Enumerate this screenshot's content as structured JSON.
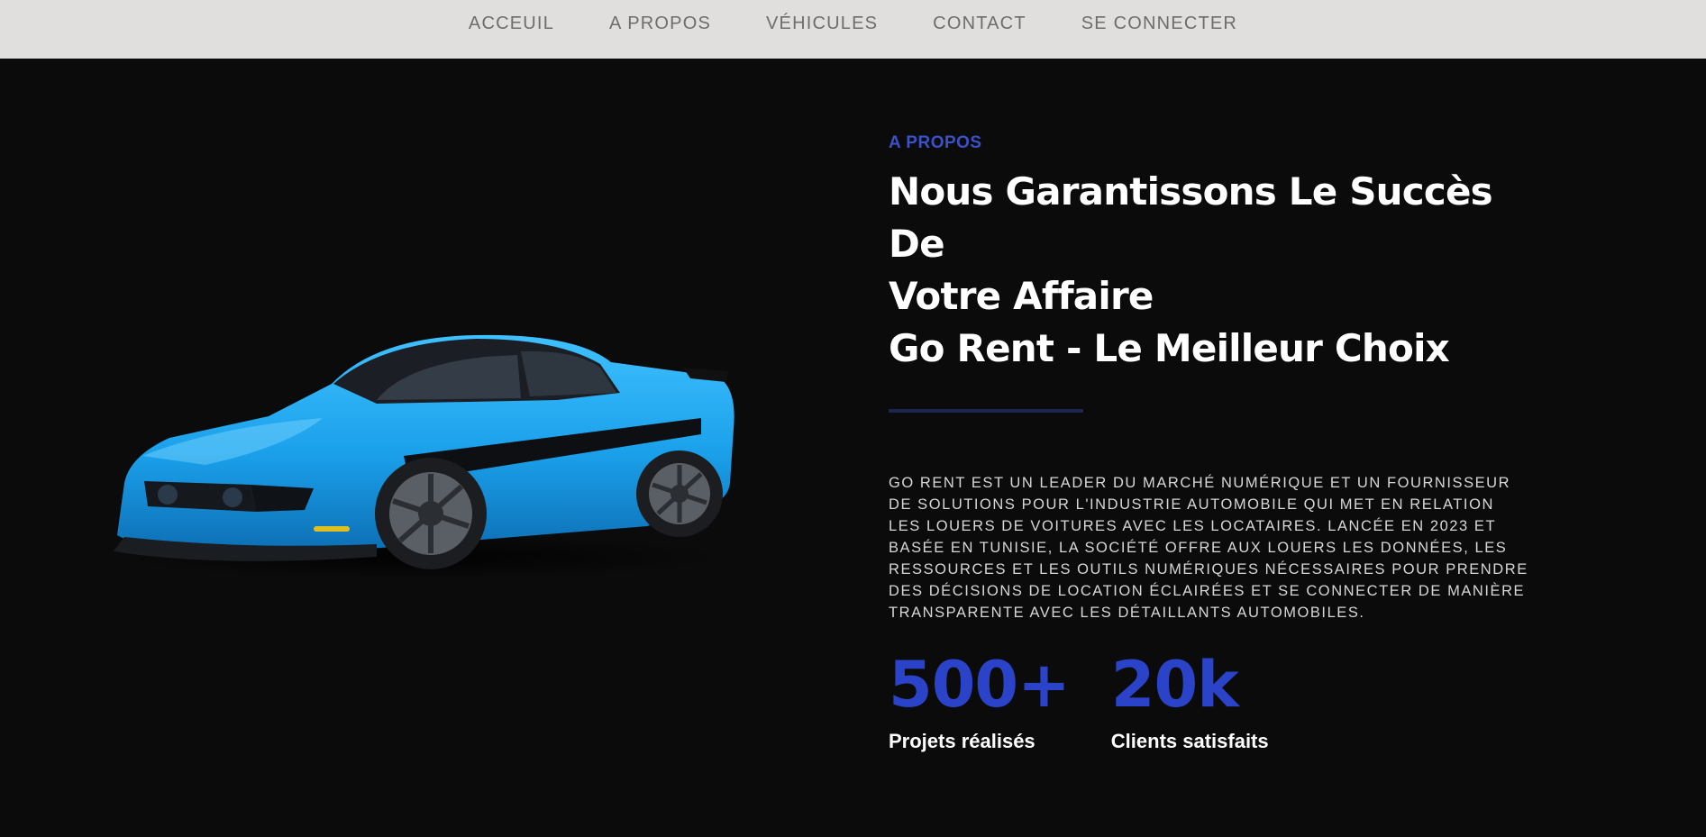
{
  "nav": {
    "items": [
      {
        "label": "ACCEUIL"
      },
      {
        "label": "A PROPOS"
      },
      {
        "label": "VÉHICULES"
      },
      {
        "label": "CONTACT"
      },
      {
        "label": "SE CONNECTER"
      }
    ]
  },
  "about": {
    "section_label": "A PROPOS",
    "headline_line1": "Nous Garantissons Le Succès De",
    "headline_line2": "Votre Affaire",
    "headline_line3": "Go Rent - Le Meilleur Choix",
    "description": "GO RENT EST UN LEADER DU MARCHÉ NUMÉRIQUE ET UN FOURNISSEUR DE SOLUTIONS POUR L'INDUSTRIE AUTOMOBILE QUI MET EN RELATION LES LOUERS DE VOITURES AVEC LES LOCATAIRES. LANCÉE EN 2023 ET BASÉE EN TUNISIE, LA SOCIÉTÉ OFFRE AUX LOUERS LES DONNÉES, LES RESSOURCES ET LES OUTILS NUMÉRIQUES NÉCESSAIRES POUR PRENDRE DES DÉCISIONS DE LOCATION ÉCLAIRÉES ET SE CONNECTER DE MANIÈRE TRANSPARENTE AVEC LES DÉTAILLANTS AUTOMOBILES.",
    "stats": [
      {
        "value": "500+",
        "label": "Projets réalisés"
      },
      {
        "value": "20k",
        "label": "Clients satisfaits"
      }
    ]
  },
  "colors": {
    "nav_background": "#e0dfdd",
    "page_background": "#0b0b0b",
    "accent": "#2b43c8",
    "car_body": "#1ea7f0"
  }
}
